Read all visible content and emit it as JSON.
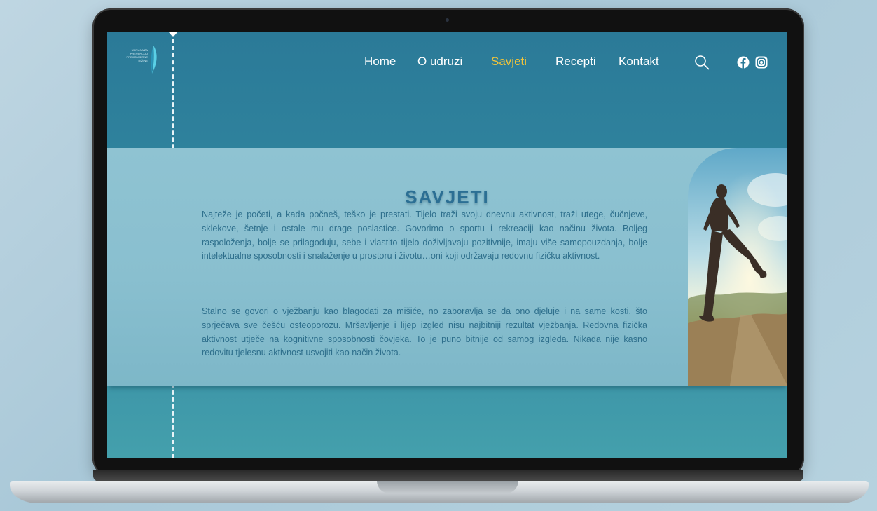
{
  "logo": {
    "lines": [
      "UDRUGA ZA",
      "PREVENCIJU",
      "PREKOMJERNE",
      "TEŽINE"
    ]
  },
  "nav": {
    "items": [
      {
        "label": "Home",
        "active": false
      },
      {
        "label": "O udruzi",
        "active": false
      },
      {
        "label": "Savjeti",
        "active": true
      },
      {
        "label": "Recepti",
        "active": false
      },
      {
        "label": "Kontakt",
        "active": false
      }
    ],
    "active_color": "#f2c43a"
  },
  "icons": {
    "search": "search-icon",
    "facebook": "facebook-icon",
    "instagram": "instagram-icon"
  },
  "section": {
    "title": "SAVJETI",
    "paragraphs": [
      "Najteže je početi, a kada počneš, teško je prestati. Tijelo traži svoju dnevnu aktivnost, traži utege, čučnjeve, sklekove, šetnje i ostale mu drage poslastice. Govorimo o sportu i rekreaciji kao načinu života. Boljeg raspoloženja, bolje se prilagođuju, sebe i vlastito tijelo doživljavaju pozitivnije, imaju više samopouzdanja, bolje intelektualne sposobnosti i snalaženje u prostoru i životu…oni koji održavaju redovnu fizičku aktivnost.",
      "Stalno se govori o vježbanju kao blagodati za mišiće, no zaboravlja se da ono djeluje i na same kosti, što sprječava sve češću osteoporozu. Mršavljenje i lijep izgled nisu najbitniji rezultat vježbanja. Redovna fizička aktivnost utječe na kognitivne sposobnosti čovjeka. To je puno bitnije od samog izgleda. Nikada nije kasno redovitu tjelesnu aktivnost usvojiti kao način života."
    ]
  },
  "colors": {
    "header_bg": "#2b7a98",
    "band_bg": "#8fc3d2",
    "title": "#2b6f94",
    "text": "#2e6f8c"
  }
}
